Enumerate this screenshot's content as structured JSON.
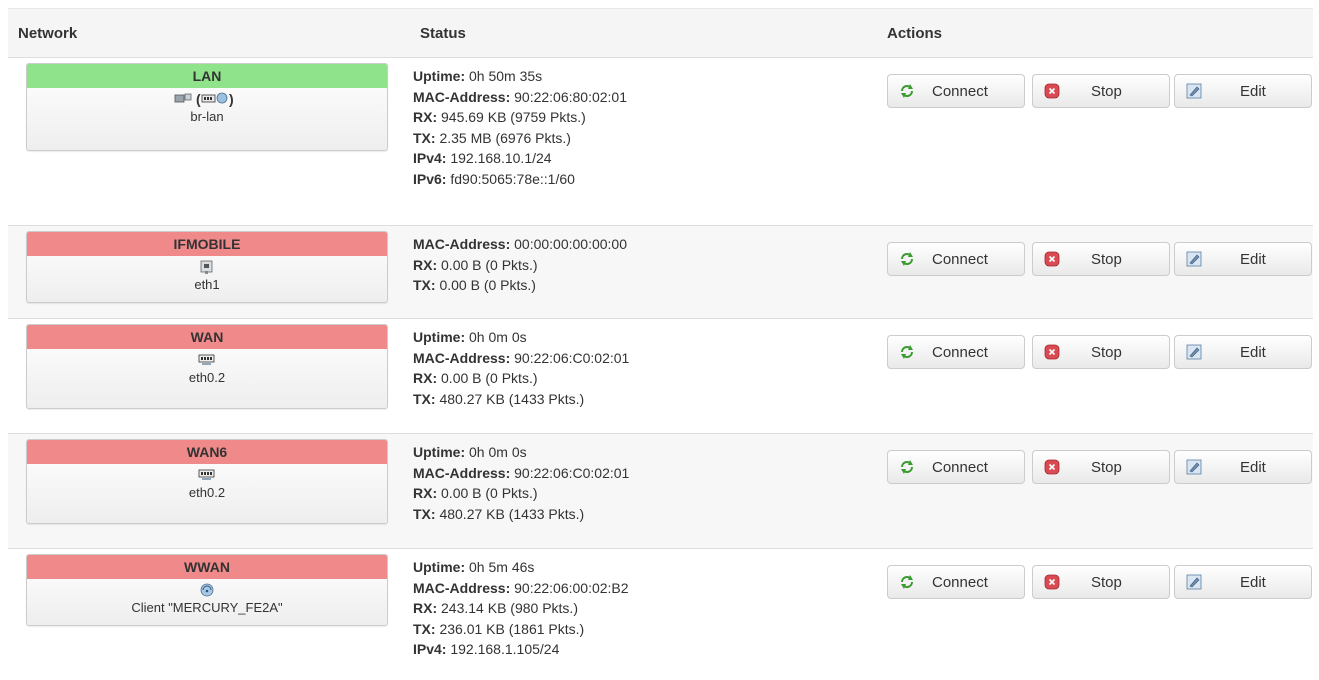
{
  "headers": {
    "network": "Network",
    "status": "Status",
    "actions": "Actions"
  },
  "colors": {
    "up": "#8fe38b",
    "down": "#f0898a"
  },
  "buttons": {
    "connect": "Connect",
    "stop": "Stop",
    "edit": "Edit"
  },
  "rows": [
    {
      "name": "LAN",
      "state": "up",
      "device": "br-lan",
      "icon": "bridge-icon",
      "status": [
        {
          "k": "Uptime:",
          "v": " 0h 50m 35s"
        },
        {
          "k": "MAC-Address:",
          "v": " 90:22:06:80:02:01"
        },
        {
          "k": "RX:",
          "v": " 945.69 KB (9759 Pkts.)"
        },
        {
          "k": "TX:",
          "v": " 2.35 MB (6976 Pkts.)"
        },
        {
          "k": "IPv4:",
          "v": " 192.168.10.1/24"
        },
        {
          "k": "IPv6:",
          "v": " fd90:5065:78e::1/60"
        }
      ]
    },
    {
      "name": "IFMOBILE",
      "state": "down",
      "device": "eth1",
      "icon": "ethernet-port-icon",
      "status": [
        {
          "k": "MAC-Address:",
          "v": " 00:00:00:00:00:00"
        },
        {
          "k": "RX:",
          "v": " 0.00 B (0 Pkts.)"
        },
        {
          "k": "TX:",
          "v": " 0.00 B (0 Pkts.)"
        }
      ]
    },
    {
      "name": "WAN",
      "state": "down",
      "device": "eth0.2",
      "icon": "switch-icon",
      "status": [
        {
          "k": "Uptime:",
          "v": " 0h 0m 0s"
        },
        {
          "k": "MAC-Address:",
          "v": " 90:22:06:C0:02:01"
        },
        {
          "k": "RX:",
          "v": " 0.00 B (0 Pkts.)"
        },
        {
          "k": "TX:",
          "v": " 480.27 KB (1433 Pkts.)"
        }
      ]
    },
    {
      "name": "WAN6",
      "state": "down",
      "device": "eth0.2",
      "icon": "switch-icon",
      "status": [
        {
          "k": "Uptime:",
          "v": " 0h 0m 0s"
        },
        {
          "k": "MAC-Address:",
          "v": " 90:22:06:C0:02:01"
        },
        {
          "k": "RX:",
          "v": " 0.00 B (0 Pkts.)"
        },
        {
          "k": "TX:",
          "v": " 480.27 KB (1433 Pkts.)"
        }
      ]
    },
    {
      "name": "WWAN",
      "state": "down",
      "device": "Client \"MERCURY_FE2A\"",
      "icon": "wifi-icon",
      "status": [
        {
          "k": "Uptime:",
          "v": " 0h 5m 46s"
        },
        {
          "k": "MAC-Address:",
          "v": " 90:22:06:00:02:B2"
        },
        {
          "k": "RX:",
          "v": " 243.14 KB (980 Pkts.)"
        },
        {
          "k": "TX:",
          "v": " 236.01 KB (1861 Pkts.)"
        },
        {
          "k": "IPv4:",
          "v": " 192.168.1.105/24"
        }
      ]
    }
  ]
}
